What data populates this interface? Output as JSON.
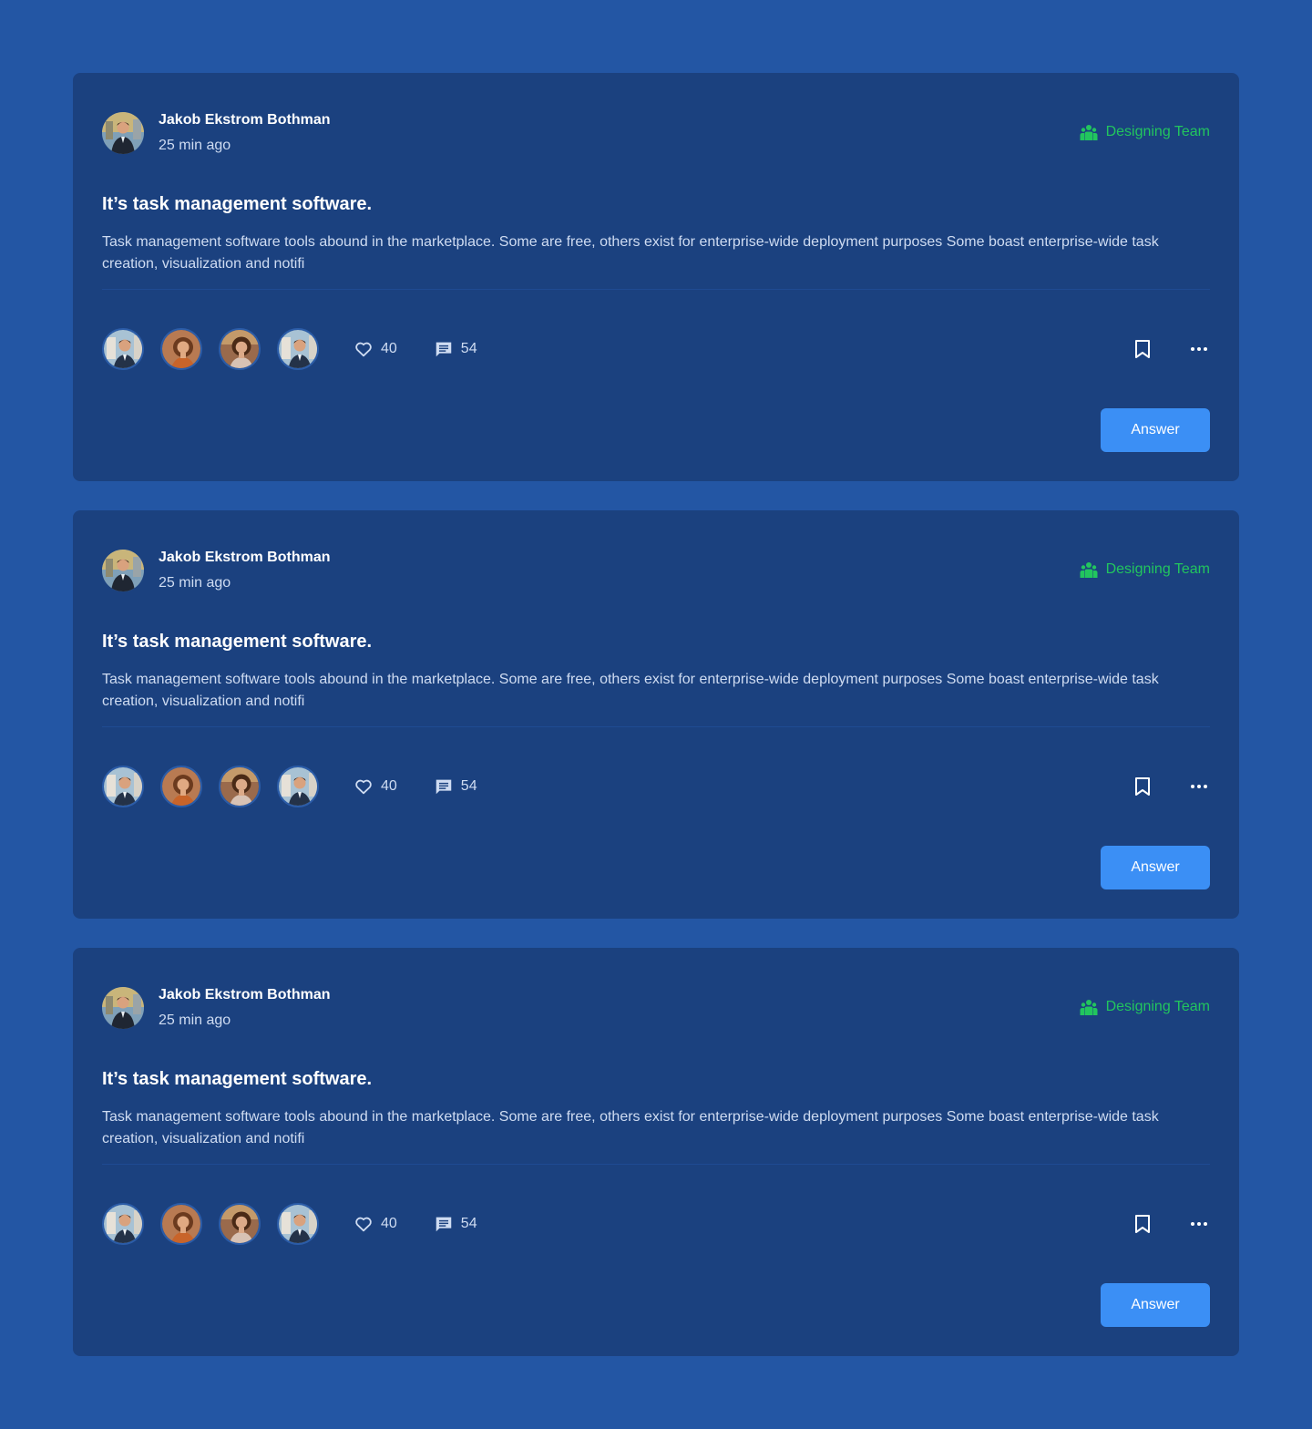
{
  "posts": [
    {
      "author_name": "Jakob Ekstrom Bothman",
      "time_ago": "25 min ago",
      "team_label": "Designing Team",
      "title": "It’s task management software.",
      "body": "Task management software tools abound in the marketplace. Some are free, others exist for enterprise-wide deployment purposes Some boast enterprise-wide task creation, visualization and notifi",
      "likes": "40",
      "comments": "54",
      "answer_label": "Answer"
    },
    {
      "author_name": "Jakob Ekstrom Bothman",
      "time_ago": "25 min ago",
      "team_label": "Designing Team",
      "title": "It’s task management software.",
      "body": "Task management software tools abound in the marketplace. Some are free, others exist for enterprise-wide deployment purposes Some boast enterprise-wide task creation, visualization and notifi",
      "likes": "40",
      "comments": "54",
      "answer_label": "Answer"
    },
    {
      "author_name": "Jakob Ekstrom Bothman",
      "time_ago": "25 min ago",
      "team_label": "Designing Team",
      "title": "It’s task management software.",
      "body": "Task management software tools abound in the marketplace. Some are free, others exist for enterprise-wide deployment purposes Some boast enterprise-wide task creation, visualization and notifi",
      "likes": "40",
      "comments": "54",
      "answer_label": "Answer"
    }
  ],
  "icons": {
    "team": "team-icon",
    "like": "heart-icon",
    "comment": "comment-icon",
    "bookmark": "bookmark-icon",
    "more": "more-icon"
  },
  "colors": {
    "page_background": "#2356a4",
    "card_background": "#1b417f",
    "team_accent": "#22c55e",
    "button_primary": "#3b8ff5"
  }
}
